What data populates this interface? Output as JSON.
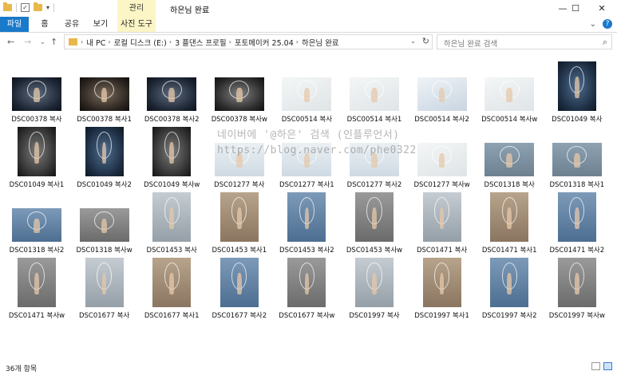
{
  "window": {
    "title": "하은님 완료",
    "context_tab_header": "관리",
    "controls": {
      "minimize": "—",
      "maximize": "☐",
      "close": "✕"
    }
  },
  "ribbon": {
    "tabs": [
      {
        "label": "파일"
      },
      {
        "label": "홈"
      },
      {
        "label": "공유"
      },
      {
        "label": "보기"
      },
      {
        "label": "사진 도구"
      }
    ],
    "expand_glyph": "⌄",
    "help_glyph": "?"
  },
  "nav": {
    "back": "←",
    "forward": "→",
    "recent": "⌄",
    "up": "↑"
  },
  "address": {
    "crumbs": [
      "내 PC",
      "로컬 디스크 (E:)",
      "3 플댄스 프로필",
      "포토메이커 25.04",
      "하은님 완료"
    ],
    "dropdown": "⌄",
    "refresh": "↻"
  },
  "search": {
    "placeholder": "하은님 완료 검색",
    "icon": "search-icon"
  },
  "files": [
    {
      "name": "DSC00378 복사",
      "style": "t-dark",
      "shape": "land"
    },
    {
      "name": "DSC00378 복사1",
      "style": "t-warm",
      "shape": "land"
    },
    {
      "name": "DSC00378 복사2",
      "style": "t-dark",
      "shape": "land"
    },
    {
      "name": "DSC00378 복사w",
      "style": "t-mono",
      "shape": "land"
    },
    {
      "name": "DSC00514 복사",
      "style": "t-light",
      "shape": "land"
    },
    {
      "name": "DSC00514 복사1",
      "style": "t-light",
      "shape": "land"
    },
    {
      "name": "DSC00514 복사2",
      "style": "t-light2",
      "shape": "land"
    },
    {
      "name": "DSC00514 복사w",
      "style": "t-light",
      "shape": "land"
    },
    {
      "name": "DSC01049 복사",
      "style": "t-blue",
      "shape": "port"
    },
    {
      "name": "DSC01049 복사1",
      "style": "t-grey",
      "shape": "port"
    },
    {
      "name": "DSC01049 복사2",
      "style": "t-blue",
      "shape": "port"
    },
    {
      "name": "DSC01049 복사w",
      "style": "t-grey",
      "shape": "port"
    },
    {
      "name": "DSC01277 복사",
      "style": "t-pale",
      "shape": "land"
    },
    {
      "name": "DSC01277 복사1",
      "style": "t-pale",
      "shape": "land"
    },
    {
      "name": "DSC01277 복사2",
      "style": "t-pale",
      "shape": "land"
    },
    {
      "name": "DSC01277 복사w",
      "style": "t-light",
      "shape": "land"
    },
    {
      "name": "DSC01318 복사",
      "style": "t-ice",
      "shape": "land"
    },
    {
      "name": "DSC01318 복사1",
      "style": "t-ice",
      "shape": "land"
    },
    {
      "name": "DSC01318 복사2",
      "style": "t-iceblue",
      "shape": "land"
    },
    {
      "name": "DSC01318 복사w",
      "style": "t-icegrey",
      "shape": "land"
    },
    {
      "name": "DSC01453 복사",
      "style": "t-icewhite",
      "shape": "port"
    },
    {
      "name": "DSC01453 복사1",
      "style": "t-icewarm",
      "shape": "port"
    },
    {
      "name": "DSC01453 복사2",
      "style": "t-iceblue",
      "shape": "port"
    },
    {
      "name": "DSC01453 복사w",
      "style": "t-icegrey",
      "shape": "port"
    },
    {
      "name": "DSC01471 복사",
      "style": "t-icewhite",
      "shape": "port"
    },
    {
      "name": "DSC01471 복사1",
      "style": "t-icewarm",
      "shape": "port"
    },
    {
      "name": "DSC01471 복사2",
      "style": "t-iceblue",
      "shape": "port"
    },
    {
      "name": "DSC01471 복사w",
      "style": "t-icegrey",
      "shape": "port"
    },
    {
      "name": "DSC01677 복사",
      "style": "t-icewhite",
      "shape": "port"
    },
    {
      "name": "DSC01677 복사1",
      "style": "t-icewarm",
      "shape": "port"
    },
    {
      "name": "DSC01677 복사2",
      "style": "t-iceblue",
      "shape": "port"
    },
    {
      "name": "DSC01677 복사w",
      "style": "t-icegrey",
      "shape": "port"
    },
    {
      "name": "DSC01997 복사",
      "style": "t-icewhite",
      "shape": "port"
    },
    {
      "name": "DSC01997 복사1",
      "style": "t-icewarm",
      "shape": "port"
    },
    {
      "name": "DSC01997 복사2",
      "style": "t-iceblue",
      "shape": "port"
    },
    {
      "name": "DSC01997 복사w",
      "style": "t-icegrey",
      "shape": "port"
    }
  ],
  "watermark": {
    "line1": "네이버에 '@하은' 검색 (인플루언서)",
    "line2": "https://blog.naver.com/phe0322"
  },
  "status": {
    "count_text": "36개 항목"
  }
}
